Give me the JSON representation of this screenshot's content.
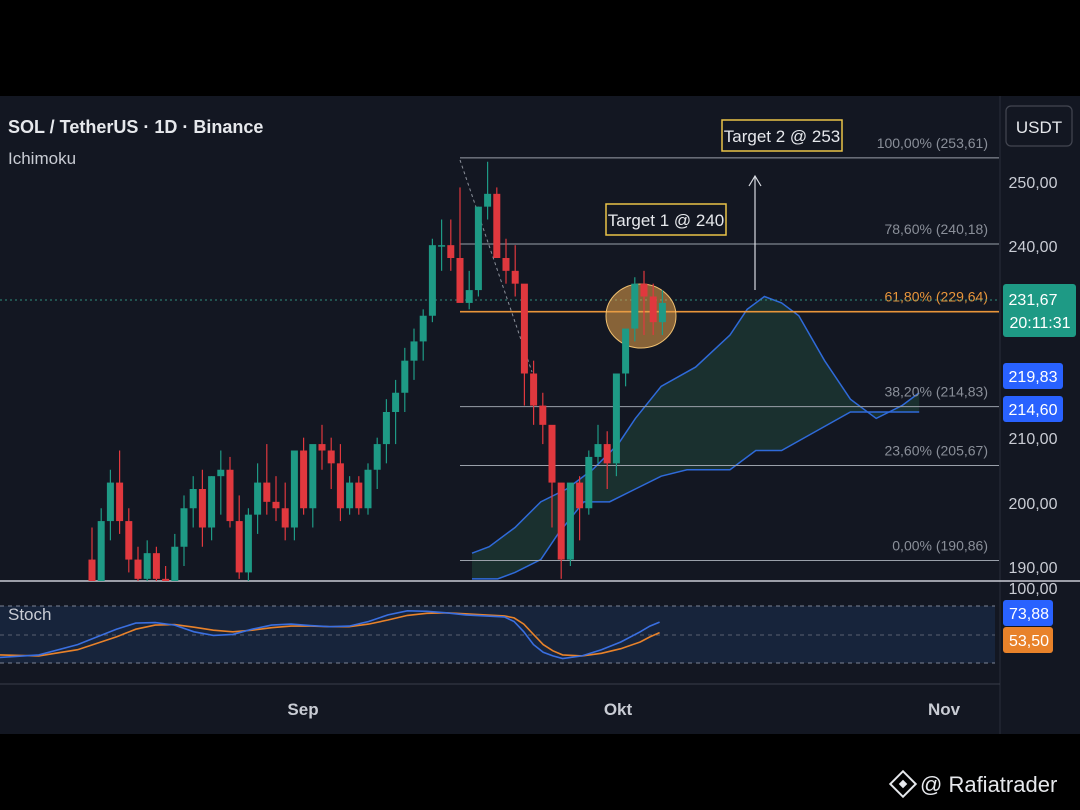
{
  "chart_data": {
    "type": "candlestick",
    "title": "SOL / TetherUS · 1D · Binance",
    "indicator_label": "Ichimoku",
    "currency": "USDT",
    "price_axis_ticks": [
      "250,00",
      "240,00",
      "210,00",
      "200,00",
      "190,00",
      "100,00"
    ],
    "time_axis_ticks": [
      "Sep",
      "Okt",
      "Nov"
    ],
    "ylim": [
      186,
      258
    ],
    "candles": [
      [
        191,
        196,
        186,
        187
      ],
      [
        187,
        199,
        186,
        197
      ],
      [
        197,
        205,
        194,
        203
      ],
      [
        203,
        208,
        195,
        197
      ],
      [
        197,
        199,
        189,
        191
      ],
      [
        191,
        193,
        186,
        188
      ],
      [
        188,
        194,
        186,
        192
      ],
      [
        192,
        193,
        186,
        188
      ],
      [
        188,
        190,
        186,
        187
      ],
      [
        187,
        195,
        186,
        193
      ],
      [
        193,
        201,
        190,
        199
      ],
      [
        199,
        204,
        196,
        202
      ],
      [
        202,
        205,
        193,
        196
      ],
      [
        196,
        204,
        194,
        204
      ],
      [
        204,
        208,
        198,
        205
      ],
      [
        205,
        207,
        196,
        197
      ],
      [
        197,
        201,
        188,
        189
      ],
      [
        189,
        199,
        187,
        198
      ],
      [
        198,
        206,
        195,
        203
      ],
      [
        203,
        209,
        198,
        200
      ],
      [
        200,
        204,
        197,
        199
      ],
      [
        199,
        203,
        194,
        196
      ],
      [
        196,
        204,
        194,
        208
      ],
      [
        208,
        210,
        198,
        199
      ],
      [
        199,
        206,
        196,
        209
      ],
      [
        209,
        212,
        205,
        208
      ],
      [
        208,
        210,
        202,
        206
      ],
      [
        206,
        209,
        197,
        199
      ],
      [
        199,
        204,
        198,
        203
      ],
      [
        203,
        204,
        198,
        199
      ],
      [
        199,
        206,
        198,
        205
      ],
      [
        205,
        210,
        202,
        209
      ],
      [
        209,
        216,
        206,
        214
      ],
      [
        214,
        219,
        209,
        217
      ],
      [
        217,
        224,
        214,
        222
      ],
      [
        222,
        227,
        219,
        225
      ],
      [
        225,
        230,
        222,
        229
      ],
      [
        229,
        241,
        228,
        240
      ],
      [
        240,
        244,
        236,
        240
      ],
      [
        240,
        244,
        236,
        238
      ],
      [
        238,
        249,
        233,
        231
      ],
      [
        231,
        236,
        230,
        233
      ],
      [
        233,
        246,
        232,
        246
      ],
      [
        246,
        253,
        244,
        248
      ],
      [
        248,
        249,
        238,
        238
      ],
      [
        238,
        241,
        234,
        236
      ],
      [
        236,
        240,
        232,
        234
      ],
      [
        234,
        233,
        215,
        220
      ],
      [
        220,
        222,
        212,
        215
      ],
      [
        215,
        217,
        209,
        212
      ],
      [
        212,
        210,
        196,
        203
      ],
      [
        203,
        200,
        188,
        191
      ],
      [
        191,
        202,
        190,
        203
      ],
      [
        203,
        204,
        194,
        199
      ],
      [
        199,
        208,
        198,
        207
      ],
      [
        207,
        212,
        206,
        209
      ],
      [
        209,
        211,
        202,
        206
      ],
      [
        206,
        216,
        204,
        220
      ],
      [
        220,
        226,
        218,
        227
      ],
      [
        227,
        235,
        225,
        234
      ],
      [
        234,
        236,
        226,
        232
      ],
      [
        232,
        234,
        226,
        228
      ],
      [
        228,
        233,
        226,
        231
      ]
    ],
    "cloud": {
      "span_a": [
        [
          0,
          192
        ],
        [
          2,
          193
        ],
        [
          5,
          196
        ],
        [
          8,
          200
        ],
        [
          11,
          202
        ],
        [
          14,
          205
        ],
        [
          17,
          209
        ],
        [
          19,
          213
        ],
        [
          22,
          218
        ],
        [
          26,
          221
        ],
        [
          30,
          226
        ],
        [
          32,
          230
        ],
        [
          34,
          232
        ],
        [
          36,
          231
        ],
        [
          38,
          229
        ],
        [
          41,
          222
        ],
        [
          44,
          216
        ],
        [
          47,
          213
        ],
        [
          50,
          215
        ],
        [
          52,
          217
        ]
      ],
      "span_b": [
        [
          0,
          188
        ],
        [
          3,
          188
        ],
        [
          5,
          189
        ],
        [
          8,
          191
        ],
        [
          10,
          195
        ],
        [
          13,
          200
        ],
        [
          16,
          200
        ],
        [
          19,
          202
        ],
        [
          22,
          204
        ],
        [
          25,
          205
        ],
        [
          30,
          205
        ],
        [
          33,
          208
        ],
        [
          36,
          208
        ],
        [
          40,
          211
        ],
        [
          44,
          214
        ],
        [
          46,
          214
        ],
        [
          49,
          214
        ],
        [
          52,
          214
        ]
      ]
    },
    "fibonacci": [
      {
        "label": "100,00% (253,61)",
        "value": 253.61
      },
      {
        "label": "78,60% (240,18)",
        "value": 240.18
      },
      {
        "label": "61,80% (229,64)",
        "value": 229.64,
        "highlight": true
      },
      {
        "label": "38,20% (214,83)",
        "value": 214.83
      },
      {
        "label": "23,60% (205,67)",
        "value": 205.67
      },
      {
        "label": "0,00% (190,86)",
        "value": 190.86
      }
    ],
    "annotations": [
      {
        "label": "Target 1 @ 240",
        "value": 240
      },
      {
        "label": "Target 2 @ 253",
        "value": 253
      }
    ],
    "price_badges": [
      {
        "label": "231,67",
        "sub": "20:11:31",
        "value": 231.67,
        "color": "#1e9a85"
      },
      {
        "label": "219,83",
        "value": 219.83,
        "color": "#2962ff"
      },
      {
        "label": "214,60",
        "value": 214.6,
        "color": "#2962ff"
      }
    ],
    "stoch": {
      "label": "Stoch",
      "ylim": [
        0,
        100
      ],
      "k": [
        [
          0,
          5
        ],
        [
          4,
          10
        ],
        [
          8,
          30
        ],
        [
          12,
          60
        ],
        [
          14,
          72
        ],
        [
          16,
          73
        ],
        [
          18,
          68
        ],
        [
          20,
          55
        ],
        [
          22,
          48
        ],
        [
          24,
          50
        ],
        [
          26,
          60
        ],
        [
          28,
          68
        ],
        [
          30,
          70
        ],
        [
          32,
          67
        ],
        [
          34,
          65
        ],
        [
          36,
          66
        ],
        [
          38,
          75
        ],
        [
          40,
          88
        ],
        [
          42,
          96
        ],
        [
          44,
          95
        ],
        [
          46,
          92
        ],
        [
          48,
          88
        ],
        [
          50,
          86
        ],
        [
          52,
          84
        ],
        [
          53,
          75
        ],
        [
          54,
          55
        ],
        [
          55,
          30
        ],
        [
          56,
          15
        ],
        [
          57,
          8
        ],
        [
          58,
          3
        ],
        [
          60,
          8
        ],
        [
          62,
          20
        ],
        [
          64,
          35
        ],
        [
          66,
          55
        ],
        [
          67,
          66
        ],
        [
          68,
          73.88
        ]
      ],
      "d": [
        [
          0,
          10
        ],
        [
          4,
          8
        ],
        [
          8,
          20
        ],
        [
          12,
          45
        ],
        [
          14,
          60
        ],
        [
          16,
          68
        ],
        [
          18,
          69
        ],
        [
          20,
          64
        ],
        [
          22,
          58
        ],
        [
          24,
          55
        ],
        [
          26,
          58
        ],
        [
          28,
          63
        ],
        [
          30,
          66
        ],
        [
          32,
          66
        ],
        [
          34,
          65
        ],
        [
          36,
          65
        ],
        [
          38,
          70
        ],
        [
          40,
          78
        ],
        [
          42,
          87
        ],
        [
          44,
          91
        ],
        [
          46,
          92
        ],
        [
          48,
          90
        ],
        [
          50,
          88
        ],
        [
          52,
          86
        ],
        [
          53,
          82
        ],
        [
          54,
          70
        ],
        [
          55,
          50
        ],
        [
          56,
          30
        ],
        [
          57,
          18
        ],
        [
          58,
          10
        ],
        [
          60,
          8
        ],
        [
          62,
          13
        ],
        [
          64,
          22
        ],
        [
          66,
          35
        ],
        [
          67,
          45
        ],
        [
          68,
          53.5
        ]
      ],
      "k_badge": "73,88",
      "d_badge": "53,50"
    },
    "colors": {
      "up": "#1e9a85",
      "down": "#e0383e",
      "cloud_line": "#2f6ad9",
      "fib_highlight": "#e8953a",
      "stoch_k": "#3a6fe0",
      "stoch_d": "#e8822a",
      "annotation_box": "#e9c348"
    }
  },
  "watermark": {
    "text": "@ Rafiatrader",
    "icon": "binance-diamond-icon"
  }
}
